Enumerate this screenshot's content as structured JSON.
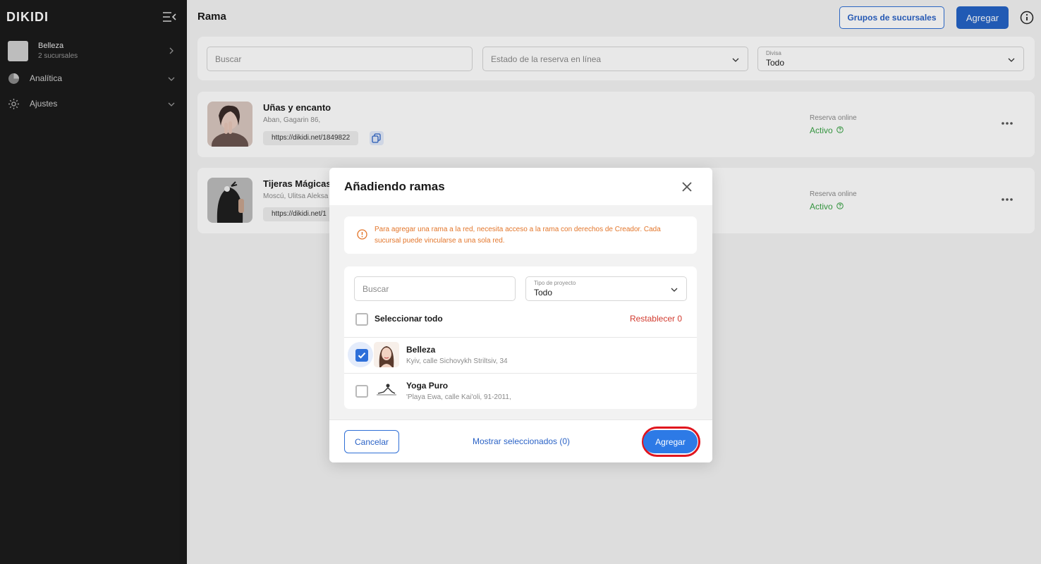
{
  "sidebar": {
    "logo": "DIKIDI",
    "account": {
      "name": "Belleza",
      "subtitle": "2 sucursales"
    },
    "items": [
      {
        "label": "Analítica",
        "icon": "pie-chart-icon"
      },
      {
        "label": "Ajustes",
        "icon": "gear-icon"
      }
    ]
  },
  "header": {
    "title": "Rama",
    "groups_button": "Grupos de sucursales",
    "add_button": "Agregar"
  },
  "filters": {
    "search_placeholder": "Buscar",
    "booking_state_placeholder": "Estado de la reserva en línea",
    "currency_label": "Divisa",
    "currency_value": "Todo"
  },
  "branches": [
    {
      "name": "Uñas y encanto",
      "address": "Aban, Gagarin 86,",
      "url": "https://dikidi.net/1849822",
      "booking_label": "Reserva online",
      "booking_status": "Activo"
    },
    {
      "name": "Tijeras Mágicas",
      "address": "Moscú, Ulitsa Aleksa",
      "url": "https://dikidi.net/1",
      "booking_label": "Reserva online",
      "booking_status": "Activo"
    }
  ],
  "modal": {
    "title": "Añadiendo ramas",
    "warning": "Para agregar una rama a la red, necesita acceso a la rama con derechos de Creador. Cada sucursal puede vincularse a una sola red.",
    "search_placeholder": "Buscar",
    "project_type_label": "Tipo de proyecto",
    "project_type_value": "Todo",
    "select_all": "Seleccionar todo",
    "reset": "Restablecer 0",
    "items": [
      {
        "name": "Belleza",
        "address": "Kyiv, calle Sichovykh Striltsiv, 34",
        "checked": true
      },
      {
        "name": "Yoga Puro",
        "address": "'Playa Ewa, calle Kai'oli, 91-2011,",
        "checked": false
      }
    ],
    "cancel": "Cancelar",
    "show_selected": "Mostrar seleccionados (0)",
    "add": "Agregar"
  },
  "colors": {
    "accent": "#2563c6",
    "success": "#3aa346",
    "warning": "#e3762b",
    "danger": "#d23b2f",
    "highlight": "#e0151e"
  }
}
